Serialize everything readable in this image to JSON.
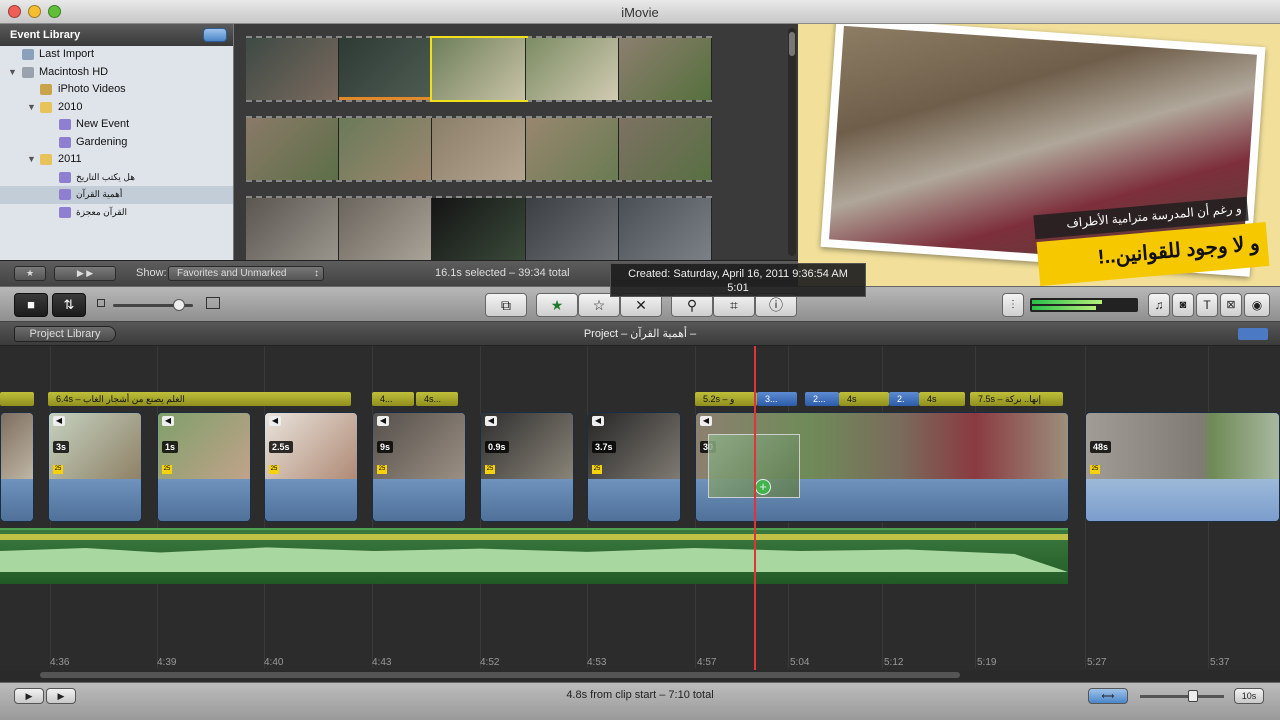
{
  "window": {
    "title": "iMovie"
  },
  "sidebar": {
    "header": "Event Library",
    "items": [
      {
        "label": "Last Import",
        "indent": 1
      },
      {
        "label": "Macintosh HD",
        "indent": 0
      },
      {
        "label": "iPhoto Videos",
        "indent": 2
      },
      {
        "label": "2010",
        "indent": 1
      },
      {
        "label": "New Event",
        "indent": 2
      },
      {
        "label": "Gardening",
        "indent": 2
      },
      {
        "label": "2011",
        "indent": 1
      },
      {
        "label": "هل يكتب التاريخ",
        "indent": 2
      },
      {
        "label": "أهمية القرآن",
        "indent": 2,
        "selected": true
      },
      {
        "label": "القرآن معجزة",
        "indent": 2
      }
    ]
  },
  "browser_status": {
    "show_label": "Show:",
    "show_value": "Favorites and Unmarked",
    "selection_info": "16.1s selected – 39:34 total"
  },
  "tooltip": {
    "line1": "Created: Saturday, April 16, 2011 9:36:54 AM",
    "line2": "5:01"
  },
  "viewer": {
    "caption_small": "و رغم أن المدرسة مترامية الأطراف",
    "caption_large": "و لا وجود للقوانين..!"
  },
  "project": {
    "back_label": "Project Library",
    "title": "Project – أهمية القرآن –"
  },
  "timeline": {
    "title_bars": [
      {
        "text": "6.4s – الغلم يصنع من أشجار الغاب",
        "blue": false
      },
      {
        "text": "4...",
        "blue": false
      },
      {
        "text": "4s...",
        "blue": false
      },
      {
        "text": "5.2s – و",
        "blue": false
      },
      {
        "text": "3...",
        "blue": true
      },
      {
        "text": "2...",
        "blue": true
      },
      {
        "text": "4s",
        "blue": false
      },
      {
        "text": "2.",
        "blue": true
      },
      {
        "text": "4s",
        "blue": false
      },
      {
        "text": "7.5s – إنها.. بركة",
        "blue": false
      }
    ],
    "clip_badges": [
      "3s",
      "1s",
      "2.5s",
      "9s",
      "0.9s",
      "3.7s",
      "30",
      "48s"
    ],
    "clip_tag": "25",
    "time_labels": [
      "4:36",
      "4:39",
      "4:40",
      "4:43",
      "4:52",
      "4:53",
      "4:57",
      "5:04",
      "5:12",
      "5:19",
      "5:27",
      "5:37"
    ]
  },
  "bottom": {
    "status": "4.8s from clip start – 7:10 total",
    "zoom_value": "10s"
  },
  "icons": {
    "toolbar": [
      "camera-icon",
      "swap-icon",
      "small-thumb-icon",
      "large-thumb-icon",
      "add-to-project-icon",
      "favorite-star-icon",
      "unmark-star-icon",
      "reject-x-icon",
      "keyword-icon",
      "crop-icon",
      "info-icon",
      "music-note-icon",
      "photo-icon",
      "title-icon",
      "transition-icon",
      "map-icon"
    ]
  },
  "colors": {
    "accent_yellow": "#f6c800",
    "playhead": "#e0333c",
    "title_green": "#bfbf3a",
    "title_blue": "#5d8bd3"
  }
}
